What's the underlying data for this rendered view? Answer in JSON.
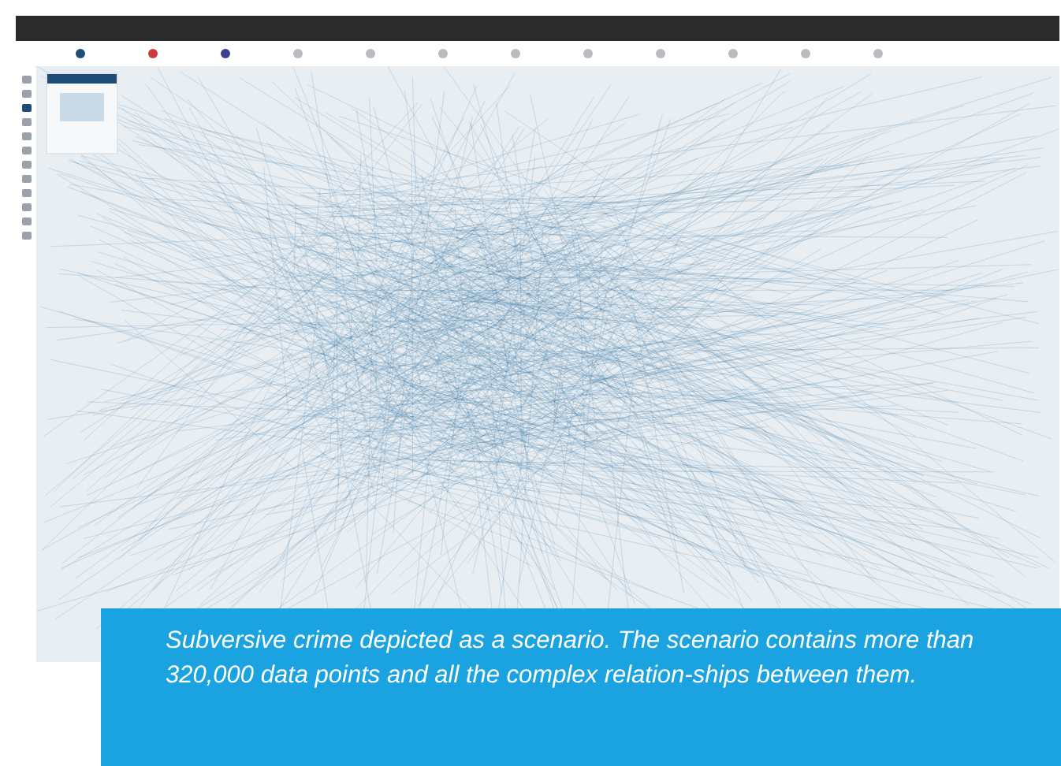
{
  "caption": "Subversive crime depicted as a scenario. The scenario contains more than 320,000 data points and all the complex relation-ships between them."
}
